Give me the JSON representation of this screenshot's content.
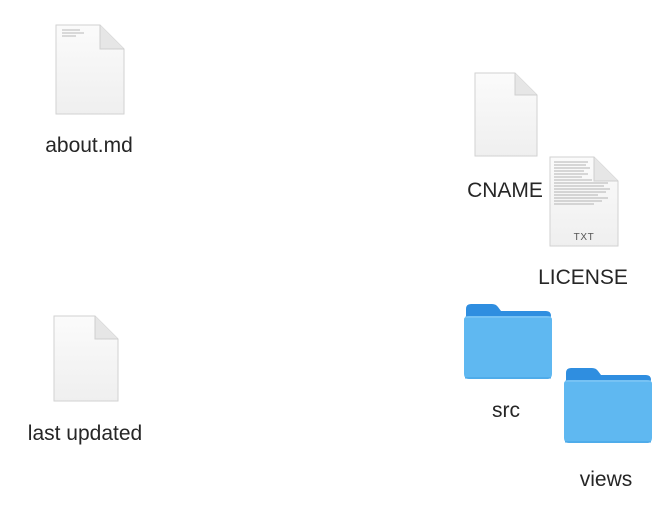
{
  "desktop": {
    "items": [
      {
        "name": "about.md",
        "icon": "text-document-icon"
      },
      {
        "name": "CNAME",
        "icon": "blank-document-icon"
      },
      {
        "name": "LICENSE",
        "icon": "text-document-icon",
        "badge": "TXT"
      },
      {
        "name": "last updated",
        "icon": "blank-document-icon"
      },
      {
        "name": "src",
        "icon": "folder-icon"
      },
      {
        "name": "views",
        "icon": "folder-icon"
      }
    ]
  },
  "colors": {
    "folder_back": "#2f8ee0",
    "folder_front": "#5fb8f1",
    "document_fill": "#f6f6f6",
    "document_edge": "#d2d2d2",
    "label_text": "#262626"
  }
}
